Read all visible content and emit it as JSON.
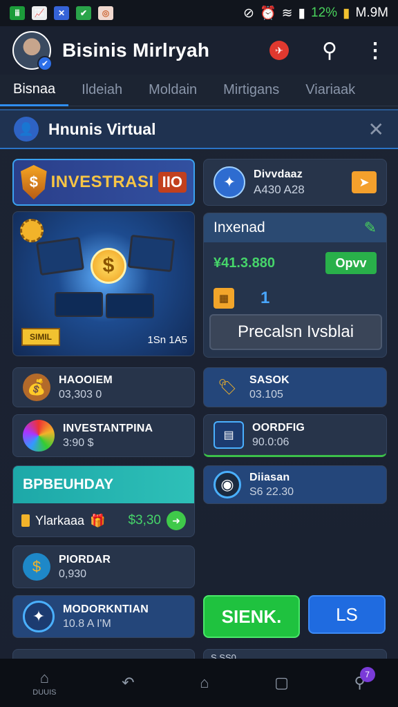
{
  "status": {
    "time": "M.9M",
    "battery": "12%"
  },
  "header": {
    "title": "Bisinis Mirlryah"
  },
  "tabs": [
    "Bisnaa",
    "Ildeiah",
    "Moldain",
    "Mirtigans",
    "Viariaak"
  ],
  "infobar": {
    "title": "Hnunis Virtual"
  },
  "banner": {
    "word": "INVESTRASI",
    "num": "IIO"
  },
  "illustration": {
    "tag": "SIMIL",
    "caption": "1Sn 1A5"
  },
  "cards": {
    "dividends": {
      "title": "Divvdaaz",
      "value": "A430 A28"
    },
    "item1": {
      "title": "HAOOIEM",
      "value": "03,303 0"
    },
    "item2": {
      "title": "SASOK",
      "value": "03.105"
    },
    "item3": {
      "title": "INVESTANTPINA",
      "value": "3:90 $"
    },
    "item4": {
      "title": "OORDFIG",
      "value": "90.0:06"
    },
    "item5": {
      "title": "Diiasan",
      "value": "S6 22.30"
    },
    "item6": {
      "title": "PIORDAR",
      "value": "0,930"
    },
    "item7": {
      "title": "MODORKNTIAN",
      "value": "10.8 A I'M"
    }
  },
  "linked": {
    "title": "Inxenad",
    "price": "¥41.3.880",
    "open": "Opvv",
    "qty": "1",
    "action": "Precalsn Ivsblai"
  },
  "teal": {
    "title": "BPBEUHDAY",
    "label": "Ylarkaaa",
    "amount": "$3,30"
  },
  "buttons": {
    "green": "SIENK.",
    "blue": "LS"
  },
  "partials": {
    "left": "",
    "right": "S.SS0"
  },
  "nav": {
    "home": "DUUIS"
  },
  "notif_count": "7"
}
